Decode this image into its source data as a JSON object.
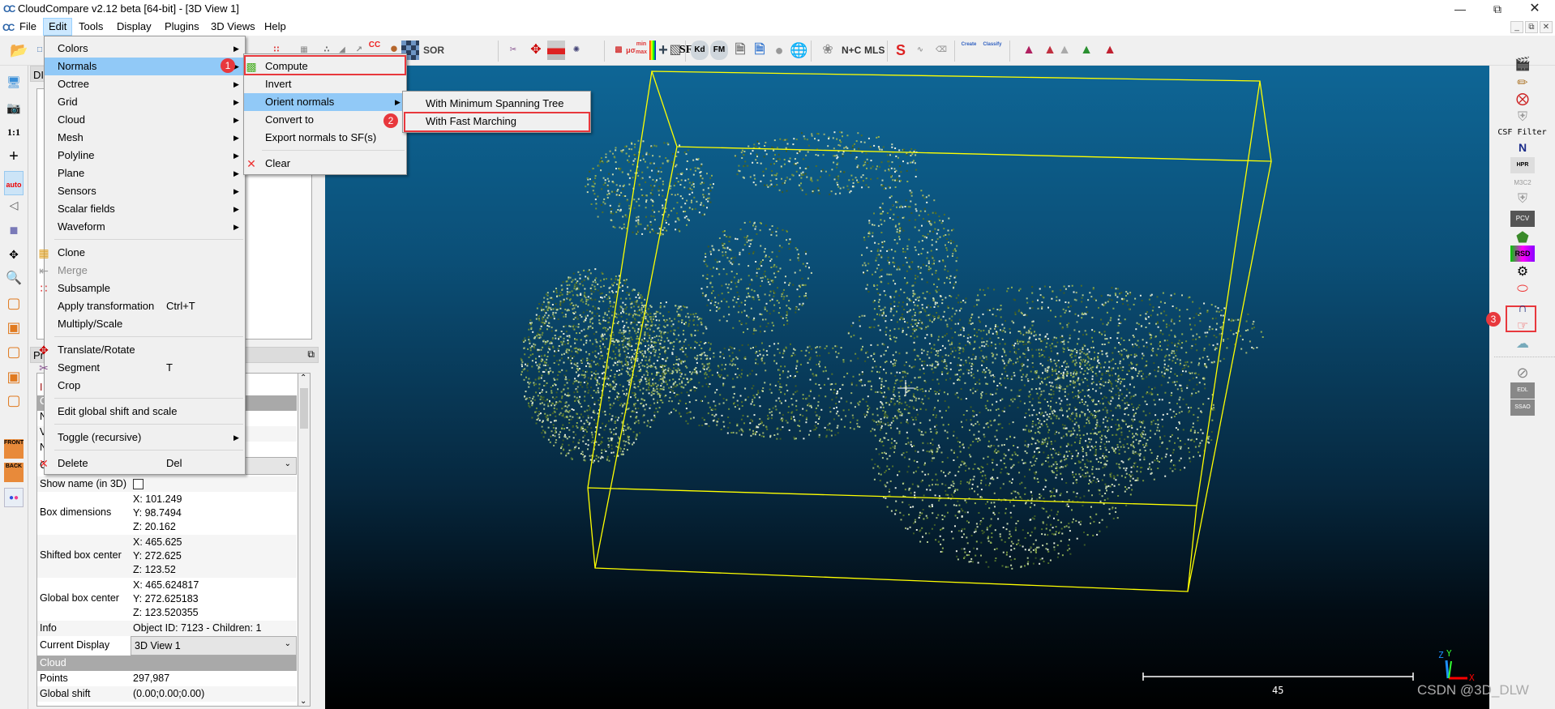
{
  "window": {
    "title": "CloudCompare v2.12 beta [64-bit] - [3D View 1]",
    "logo": "CC",
    "controls": [
      "minimize",
      "restore",
      "close"
    ]
  },
  "menubar": {
    "items": [
      "File",
      "Edit",
      "Tools",
      "Display",
      "Plugins",
      "3D Views",
      "Help"
    ],
    "active": "Edit"
  },
  "toolbar": {
    "labels": {
      "cc": "CC",
      "sor": "SOR",
      "sf": "SF",
      "kd": "Kd",
      "fm": "FM",
      "nc": "N+C",
      "mls": "MLS",
      "canupo_create": "Create",
      "canupo_classify": "Classify",
      "minmax": "min max"
    }
  },
  "left_toolbar": {
    "ratio": "1:1",
    "auto": "auto",
    "front": "FRONT",
    "back": "BACK"
  },
  "db_panel": {
    "tab_fragment": "DI"
  },
  "properties": {
    "tab_fragment": "Pr",
    "hidden_row_fragments": [
      "I",
      "C",
      "N",
      "V",
      "N",
      "C"
    ],
    "rows": [
      {
        "key": "Show name (in 3D)",
        "checkbox": false
      },
      {
        "key": "Box dimensions",
        "value": [
          "X: 101.249",
          "Y: 98.7494",
          "Z: 20.162"
        ]
      },
      {
        "key": "Shifted box center",
        "value": [
          "X: 465.625",
          "Y: 272.625",
          "Z: 123.52"
        ]
      },
      {
        "key": "Global box center",
        "value": [
          "X: 465.624817",
          "Y: 272.625183",
          "Z: 123.520355"
        ]
      },
      {
        "key": "Info",
        "value": "Object ID: 7123 - Children: 1"
      },
      {
        "key": "Current Display",
        "value": "3D View 1"
      }
    ],
    "cloud_group": "Cloud",
    "cloud_rows": [
      {
        "key": "Points",
        "value": "297,987"
      },
      {
        "key": "Global shift",
        "value": "(0.00;0.00;0.00)"
      }
    ]
  },
  "edit_menu": {
    "items": [
      {
        "label": "Colors",
        "submenu": true
      },
      {
        "label": "Normals",
        "submenu": true,
        "highlighted": true
      },
      {
        "label": "Octree",
        "submenu": true
      },
      {
        "label": "Grid",
        "submenu": true
      },
      {
        "label": "Cloud",
        "submenu": true
      },
      {
        "label": "Mesh",
        "submenu": true
      },
      {
        "label": "Polyline",
        "submenu": true
      },
      {
        "label": "Plane",
        "submenu": true
      },
      {
        "label": "Sensors",
        "submenu": true
      },
      {
        "label": "Scalar fields",
        "submenu": true
      },
      {
        "label": "Waveform",
        "submenu": true
      },
      {
        "label": "Clone",
        "icon": "clone-icon"
      },
      {
        "label": "Merge",
        "icon": "merge-icon",
        "disabled": true
      },
      {
        "label": "Subsample",
        "icon": "subsample-icon"
      },
      {
        "label": "Apply transformation",
        "shortcut": "Ctrl+T"
      },
      {
        "label": "Multiply/Scale"
      },
      {
        "label": "Translate/Rotate",
        "icon": "translate-rotate-icon"
      },
      {
        "label": "Segment",
        "icon": "scissors-icon",
        "shortcut": "T"
      },
      {
        "label": "Crop"
      },
      {
        "label": "Edit global shift and scale"
      },
      {
        "label": "Toggle (recursive)",
        "submenu": true
      },
      {
        "label": "Delete",
        "icon": "delete-icon",
        "shortcut": "Del"
      }
    ]
  },
  "normals_menu": {
    "items": [
      {
        "label": "Compute",
        "icon": "compute-normals-icon"
      },
      {
        "label": "Invert"
      },
      {
        "label": "Orient normals",
        "submenu": true,
        "highlighted": true
      },
      {
        "label": "Convert to"
      },
      {
        "label": "Export normals to SF(s)"
      },
      {
        "label": "Clear",
        "icon": "clear-icon"
      }
    ]
  },
  "orient_menu": {
    "items": [
      {
        "label": "With Minimum Spanning Tree"
      },
      {
        "label": "With Fast Marching"
      }
    ]
  },
  "annotations": {
    "badges": [
      "1",
      "2",
      "3"
    ],
    "color": "#e8383d"
  },
  "right_toolbar": {
    "csf_label": "CSF Filter",
    "hpr": "HPR",
    "m3c2": "M3C2",
    "pcv": "PCV",
    "rsd": "RSD",
    "edl": "EDL",
    "ssao": "SSAO",
    "n": "N"
  },
  "view": {
    "scale_value": "45",
    "axes": {
      "x": "X",
      "y": "Y",
      "z": "Z"
    },
    "bbox_color": "#ffff00",
    "bg_top": "#0e6696",
    "bg_bottom": "#000000"
  },
  "watermark": "CSDN @3D_DLW"
}
